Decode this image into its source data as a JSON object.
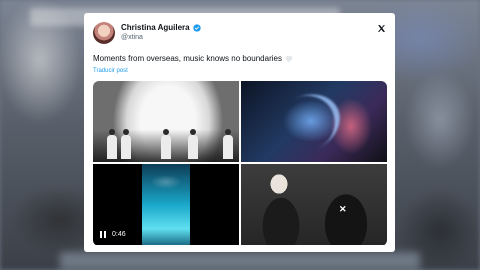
{
  "tweet": {
    "author_name": "Christina Aguilera",
    "handle": "@xtina",
    "text": "Moments from overseas, music knows no boundaries",
    "translate_label": "Traducir post",
    "media": {
      "video_duration": "0:46"
    }
  },
  "colors": {
    "verified": "#1d9bf0",
    "link": "#1d9bf0",
    "text": "#0f1419",
    "secondary": "#536471"
  },
  "icons": [
    "verified-badge-icon",
    "x-logo-icon",
    "white-heart-icon",
    "pause-icon"
  ]
}
